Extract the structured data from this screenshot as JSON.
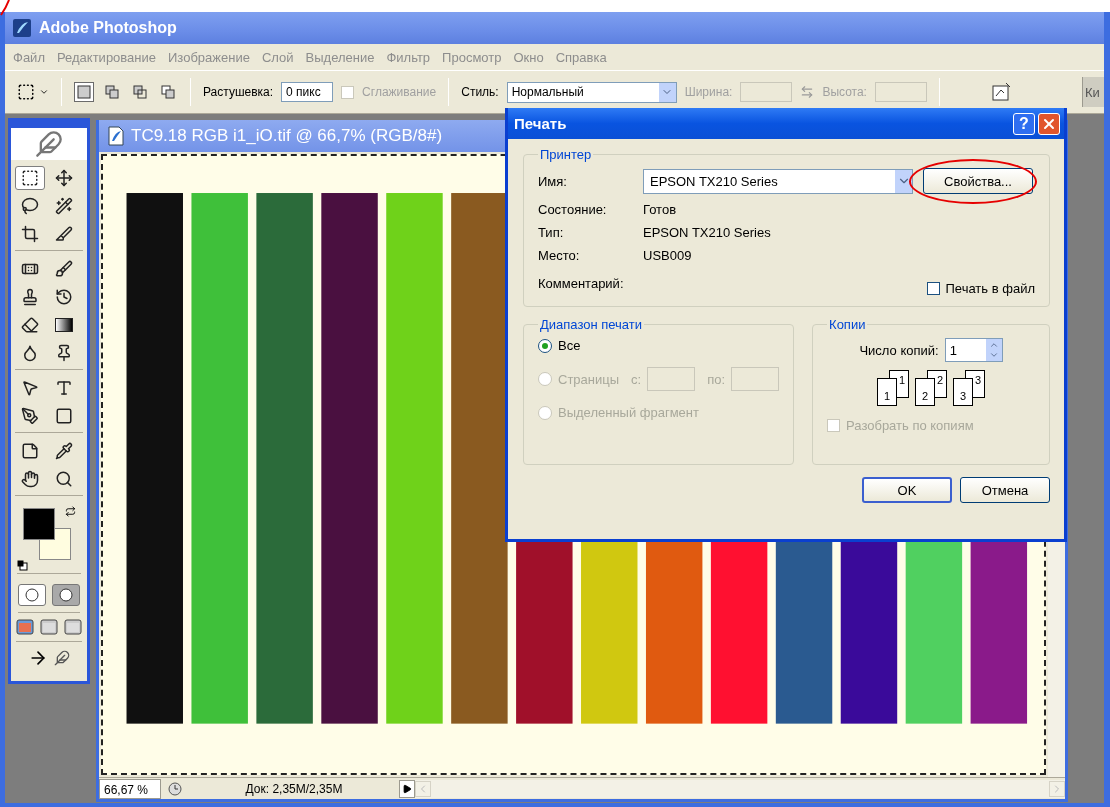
{
  "app": {
    "title": "Adobe Photoshop"
  },
  "menu": [
    "Файл",
    "Редактирование",
    "Изображение",
    "Слой",
    "Выделение",
    "Фильтр",
    "Просмотр",
    "Окно",
    "Справка"
  ],
  "options_bar": {
    "modes": [
      {
        "selected": true
      },
      {
        "selected": false
      },
      {
        "selected": false
      },
      {
        "selected": false
      }
    ],
    "feather_label": "Растушевка:",
    "feather_value": "0 пикс",
    "antialias": {
      "label": "Сглаживание",
      "checked": false,
      "disabled": true
    },
    "style_label": "Стиль:",
    "style_value": "Нормальный",
    "width": {
      "label": "Ширина:",
      "disabled": true
    },
    "height": {
      "label": "Высота:",
      "disabled": true
    },
    "palette_tab": "Ки"
  },
  "document": {
    "title": "TC9.18 RGB i1_iO.tif @ 66,7% (RGB/8#)",
    "zoom": "66,67 %",
    "doc_info": "Док: 2,35M/2,35M"
  },
  "dialog": {
    "title": "Печать",
    "help": "?",
    "printer": {
      "legend": "Принтер",
      "name_label": "Имя:",
      "name_value": "EPSON TX210 Series",
      "properties_button": "Свойства...",
      "info": [
        {
          "label": "Состояние:",
          "value": "Готов"
        },
        {
          "label": "Тип:",
          "value": "EPSON TX210 Series"
        },
        {
          "label": "Место:",
          "value": "USB009"
        },
        {
          "label": "Комментарий:"
        }
      ],
      "print_to_file": {
        "label": "Печать в файл",
        "checked": false
      }
    },
    "range": {
      "legend": "Диапазон печати",
      "options": [
        {
          "label": "Все",
          "selected": true,
          "disabled": false
        },
        {
          "label": "Страницы",
          "selected": false,
          "disabled": true
        },
        {
          "label": "Выделенный фрагмент",
          "selected": false,
          "disabled": true
        }
      ],
      "from_label": "с:",
      "to_label": "по:"
    },
    "copies": {
      "legend": "Копии",
      "count_label": "Число копий:",
      "count_value": "1",
      "collate_pages": [
        {
          "front": "1",
          "back": "1"
        },
        {
          "front": "2",
          "back": "2"
        },
        {
          "front": "3",
          "back": "3"
        }
      ],
      "collate": {
        "label": "Разобрать по копиям",
        "checked": false,
        "disabled": true
      }
    },
    "buttons": [
      "OK",
      "Отмена"
    ]
  }
}
